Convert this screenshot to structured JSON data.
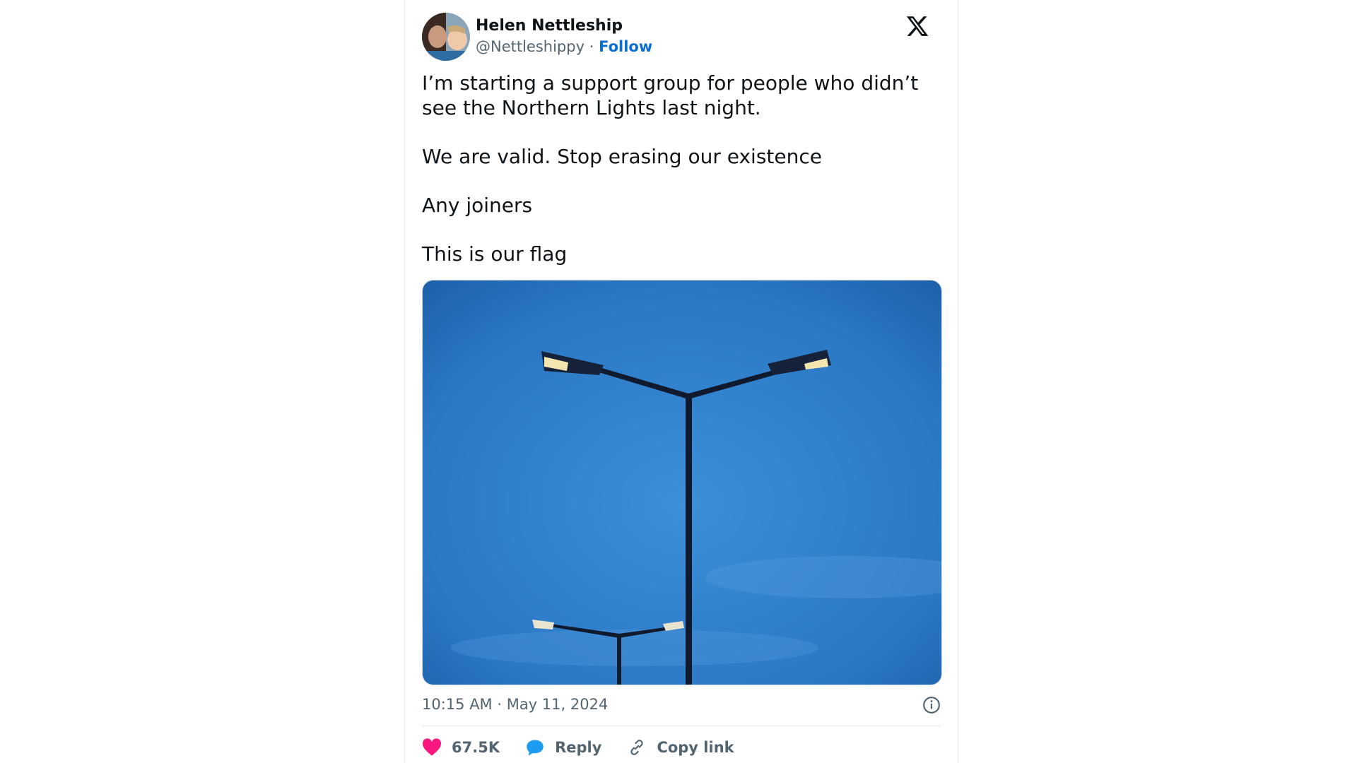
{
  "author": {
    "name": "Helen Nettleship",
    "handle": "@Nettleshippy",
    "separator": "·",
    "follow_label": "Follow"
  },
  "post": {
    "paragraphs": [
      "I’m starting a support group for people who didn’t see the Northern Lights last night.",
      "We are valid. Stop erasing our existence",
      "Any joiners",
      "This is our flag"
    ],
    "timestamp": "10:15 AM · May 11, 2024"
  },
  "actions": {
    "like_count": "67.5K",
    "reply_label": "Reply",
    "copy_label": "Copy link"
  },
  "icons": [
    "x-logo-icon",
    "info-icon",
    "heart-icon",
    "reply-bubble-icon",
    "link-icon"
  ],
  "colors": {
    "follow": "#0a6ed1",
    "heart": "#f91880",
    "reply": "#1d9bf0",
    "sky": "#2f80d0"
  }
}
